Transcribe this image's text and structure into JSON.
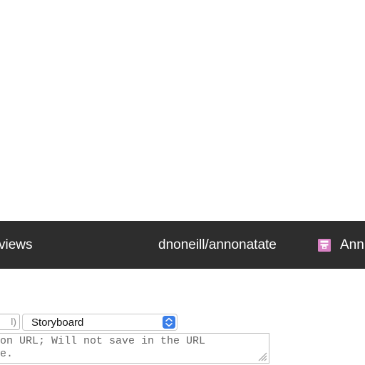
{
  "toolbar": {
    "views_label": "views",
    "repo_label": "dnoneill/annonatate",
    "annotations_label": "Ann",
    "annotations_icon": "annotation-save-icon"
  },
  "form": {
    "left_field_value": "l)",
    "select_value": "Storyboard",
    "textarea_text": "ion URL; Will not save in the URL\nle."
  },
  "colors": {
    "bar_background": "#2d2d2d",
    "icon_pink": "#d982c4",
    "select_arrow_blue": "#3a7ee8"
  }
}
